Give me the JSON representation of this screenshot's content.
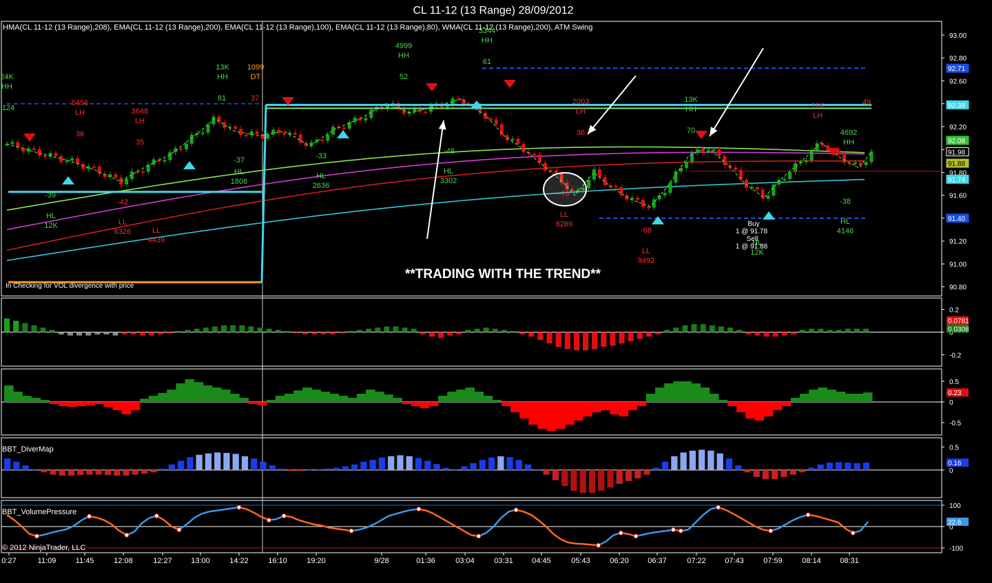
{
  "title": "CL 11-12 (13 Range)  28/09/2012",
  "indicator_legend": "HMA(CL 11-12 (13 Range),208), EMA(CL 11-12 (13 Range),200), EMA(CL 11-12 (13 Range),100), EMA(CL 11-12 (13 Range),80), WMA(CL 11-12 (13 Range),200), ATM Swing",
  "headline": "**TRADING WITH THE TREND**",
  "note": "In Checking for VOL divergence with price",
  "copyright": "© 2012 NinjaTrader, LLC",
  "trade_note": [
    "Buy",
    "1 @ 91.78",
    "Sell",
    "1 @ 91.88"
  ],
  "colors": {
    "background": "#000000",
    "up": "#1aa31a",
    "down": "#e01010",
    "grid": "#ffffff",
    "swing_green": "#4cd44c",
    "swing_red": "#ff2a2a",
    "cyan": "#40d8e8",
    "orange": "#ff9a1e"
  },
  "chart_data": [
    {
      "type": "candlestick",
      "panel": "price",
      "y_ticks": [
        "93.00",
        "92.80",
        "92.60",
        "92.40",
        "92.20",
        "92.00",
        "91.80",
        "91.60",
        "91.40",
        "91.20",
        "91.00",
        "90.80"
      ],
      "ylim": [
        90.72,
        93.12
      ],
      "x_ticks": [
        "0:27",
        "11:09",
        "11:45",
        "12:08",
        "12:27",
        "13:00",
        "14:22",
        "16:10",
        "19:20",
        "9/28",
        "01:36",
        "03:04",
        "03:31",
        "04:45",
        "05:43",
        "06:20",
        "06:37",
        "07:22",
        "07:43",
        "07:59",
        "08:14",
        "08:31"
      ],
      "price_path": [
        [
          0,
          92.05
        ],
        [
          5,
          91.97
        ],
        [
          10,
          91.9
        ],
        [
          14,
          91.82
        ],
        [
          18,
          91.72
        ],
        [
          22,
          91.85
        ],
        [
          26,
          91.96
        ],
        [
          30,
          92.13
        ],
        [
          33,
          92.27
        ],
        [
          36,
          92.16
        ],
        [
          40,
          92.12
        ],
        [
          44,
          92.16
        ],
        [
          48,
          92.03
        ],
        [
          52,
          92.18
        ],
        [
          56,
          92.27
        ],
        [
          60,
          92.4
        ],
        [
          64,
          92.32
        ],
        [
          68,
          92.38
        ],
        [
          72,
          92.44
        ],
        [
          76,
          92.29
        ],
        [
          79,
          92.11
        ],
        [
          82,
          92.0
        ],
        [
          85,
          91.86
        ],
        [
          88,
          91.72
        ],
        [
          90,
          91.6
        ],
        [
          93,
          91.8
        ],
        [
          96,
          91.66
        ],
        [
          99,
          91.56
        ],
        [
          102,
          91.5
        ],
        [
          105,
          91.7
        ],
        [
          108,
          91.94
        ],
        [
          111,
          92.02
        ],
        [
          114,
          91.88
        ],
        [
          117,
          91.7
        ],
        [
          120,
          91.58
        ],
        [
          123,
          91.76
        ],
        [
          126,
          91.9
        ],
        [
          129,
          92.06
        ],
        [
          132,
          91.93
        ],
        [
          135,
          91.84
        ],
        [
          137,
          91.98
        ]
      ],
      "candle_count": 160,
      "right_labels": [
        {
          "value": 92.71,
          "text": "92.71",
          "color": "#1a4fe8"
        },
        {
          "value": 92.39,
          "text": "92.39",
          "color": "#40d8e8"
        },
        {
          "value": 92.08,
          "text": "92.08",
          "color": "#2ec82e"
        },
        {
          "value": 91.98,
          "text": "91.98",
          "color": "#000000"
        },
        {
          "value": 91.88,
          "text": "91.88",
          "color": "#b0c020"
        },
        {
          "value": 91.74,
          "text": "91.74",
          "color": "#40d8e8"
        },
        {
          "value": 91.4,
          "text": "91.40",
          "color": "#1a4fe8"
        }
      ],
      "swing_labels": [
        {
          "lines": [
            "24K",
            "HH"
          ],
          "color": "#4cd44c"
        },
        {
          "lines": [
            "124"
          ],
          "color": "#4cd44c"
        },
        {
          "lines": [
            "5456",
            "LH"
          ],
          "color": "#ff2a2a"
        },
        {
          "lines": [
            "36"
          ],
          "color": "#ff2a2a"
        },
        {
          "lines": [
            "3648",
            "LH"
          ],
          "color": "#ff2a2a"
        },
        {
          "lines": [
            "35"
          ],
          "color": "#ff2a2a"
        },
        {
          "lines": [
            "13K",
            "HH"
          ],
          "color": "#4cd44c"
        },
        {
          "lines": [
            "81"
          ],
          "color": "#4cd44c"
        },
        {
          "lines": [
            "1099",
            "DT"
          ],
          "color": "#ffa020"
        },
        {
          "lines": [
            "37"
          ],
          "color": "#ff2a2a"
        },
        {
          "lines": [
            "4999",
            "HH"
          ],
          "color": "#4cd44c"
        },
        {
          "lines": [
            "52"
          ],
          "color": "#4cd44c"
        },
        {
          "lines": [
            "3344",
            "HH"
          ],
          "color": "#4cd44c"
        },
        {
          "lines": [
            "61"
          ],
          "color": "#4cd44c"
        },
        {
          "lines": [
            "2003",
            "LH"
          ],
          "color": "#ff2a2a"
        },
        {
          "lines": [
            "36"
          ],
          "color": "#ff2a2a"
        },
        {
          "lines": [
            "13K",
            "HH"
          ],
          "color": "#4cd44c"
        },
        {
          "lines": [
            "70"
          ],
          "color": "#4cd44c"
        },
        {
          "lines": [
            "11K",
            "LH"
          ],
          "color": "#ff2a2a"
        },
        {
          "lines": [
            "4692",
            "HH"
          ],
          "color": "#4cd44c"
        },
        {
          "lines": [
            "49"
          ],
          "color": "#ff2a2a"
        },
        {
          "lines": [
            "-39"
          ],
          "color": "#4cd44c"
        },
        {
          "lines": [
            "HL",
            "12K"
          ],
          "color": "#4cd44c"
        },
        {
          "lines": [
            "-42"
          ],
          "color": "#ff2a2a"
        },
        {
          "lines": [
            "LL",
            "6326"
          ],
          "color": "#ff2a2a"
        },
        {
          "lines": [
            "LL",
            "4439"
          ],
          "color": "#ff2a2a"
        },
        {
          "lines": [
            "-37"
          ],
          "color": "#4cd44c"
        },
        {
          "lines": [
            "HL",
            "1808"
          ],
          "color": "#4cd44c"
        },
        {
          "lines": [
            "-33"
          ],
          "color": "#4cd44c"
        },
        {
          "lines": [
            "HL",
            "2636"
          ],
          "color": "#4cd44c"
        },
        {
          "lines": [
            "-48"
          ],
          "color": "#4cd44c"
        },
        {
          "lines": [
            "HL",
            "3302"
          ],
          "color": "#4cd44c"
        },
        {
          "lines": [
            "-70"
          ],
          "color": "#ff2a2a"
        },
        {
          "lines": [
            "LL",
            "8289"
          ],
          "color": "#ff2a2a"
        },
        {
          "lines": [
            "-68"
          ],
          "color": "#ff2a2a"
        },
        {
          "lines": [
            "LL",
            "9492"
          ],
          "color": "#ff2a2a"
        },
        {
          "lines": [
            "HL",
            "12K"
          ],
          "color": "#4cd44c"
        },
        {
          "lines": [
            "-38"
          ],
          "color": "#4cd44c"
        },
        {
          "lines": [
            "HL",
            "4146"
          ],
          "color": "#4cd44c"
        }
      ]
    },
    {
      "type": "histogram",
      "panel": "oscillator_1",
      "y_ticks": [
        "0.2",
        "0",
        "-0.2"
      ],
      "ylim": [
        -0.3,
        0.3
      ],
      "value_label": "0.0308",
      "value_label_red": "0.0781",
      "values": [
        0.12,
        0.1,
        0.08,
        0.06,
        0.04,
        0.02,
        -0.02,
        -0.03,
        -0.03,
        -0.03,
        -0.02,
        -0.02,
        -0.03,
        -0.02,
        -0.02,
        -0.03,
        -0.03,
        -0.02,
        -0.01,
        0.01,
        0.02,
        0.03,
        0.04,
        0.05,
        0.06,
        0.06,
        0.06,
        0.05,
        0.04,
        0.03,
        0.02,
        0.01,
        -0.01,
        -0.02,
        -0.02,
        -0.02,
        -0.02,
        -0.01,
        0.01,
        0.02,
        0.03,
        0.04,
        0.05,
        0.05,
        0.04,
        0.03,
        -0.02,
        -0.04,
        -0.05,
        -0.03,
        -0.02,
        0.02,
        0.03,
        0.04,
        0.03,
        0.02,
        0.01,
        -0.02,
        -0.04,
        -0.07,
        -0.1,
        -0.13,
        -0.15,
        -0.16,
        -0.16,
        -0.15,
        -0.13,
        -0.12,
        -0.1,
        -0.08,
        -0.06,
        -0.04,
        -0.02,
        0.02,
        0.04,
        0.06,
        0.07,
        0.07,
        0.06,
        0.05,
        0.04,
        0.02,
        -0.02,
        -0.03,
        -0.04,
        -0.04,
        -0.03,
        -0.02,
        0.02,
        0.03,
        0.03,
        0.02,
        0.02,
        0.03,
        0.03,
        0.03
      ]
    },
    {
      "type": "histogram",
      "panel": "oscillator_2",
      "y_ticks": [
        "0.5",
        "0",
        "-0.5"
      ],
      "ylim": [
        -0.8,
        0.8
      ],
      "value_label": "0.23",
      "values": [
        0.4,
        0.25,
        0.15,
        0.1,
        0.05,
        -0.05,
        -0.1,
        -0.12,
        -0.1,
        -0.08,
        -0.05,
        -0.12,
        -0.2,
        -0.3,
        -0.2,
        0.08,
        0.15,
        0.22,
        0.3,
        0.45,
        0.55,
        0.48,
        0.4,
        0.35,
        0.3,
        0.2,
        0.1,
        -0.05,
        -0.08,
        0.05,
        0.15,
        0.2,
        0.28,
        0.35,
        0.3,
        0.25,
        0.2,
        0.15,
        0.1,
        0.2,
        0.3,
        0.25,
        0.18,
        0.1,
        -0.05,
        -0.1,
        -0.15,
        -0.1,
        0.15,
        0.25,
        0.3,
        0.35,
        0.25,
        0.15,
        0.05,
        -0.1,
        -0.25,
        -0.4,
        -0.55,
        -0.65,
        -0.7,
        -0.65,
        -0.55,
        -0.45,
        -0.35,
        -0.25,
        -0.2,
        -0.3,
        -0.35,
        -0.2,
        -0.1,
        0.2,
        0.35,
        0.45,
        0.5,
        0.5,
        0.45,
        0.35,
        0.2,
        0.05,
        -0.1,
        -0.25,
        -0.4,
        -0.45,
        -0.35,
        -0.2,
        -0.1,
        0.1,
        0.2,
        0.3,
        0.35,
        0.3,
        0.25,
        0.2,
        0.2,
        0.23
      ]
    },
    {
      "type": "histogram",
      "panel": "diver_map",
      "label": "BBT_DiverMap",
      "y_ticks": [
        "0.5",
        "0"
      ],
      "ylim": [
        -0.6,
        0.7
      ],
      "value_label": "0.16",
      "values": [
        0.25,
        0.18,
        0.1,
        0.02,
        -0.05,
        -0.1,
        -0.12,
        -0.12,
        -0.11,
        -0.1,
        -0.1,
        -0.11,
        -0.12,
        -0.12,
        -0.1,
        -0.08,
        -0.05,
        0.03,
        0.12,
        0.2,
        0.28,
        0.33,
        0.36,
        0.38,
        0.37,
        0.35,
        0.3,
        0.25,
        0.18,
        0.1,
        0.03,
        -0.02,
        -0.02,
        0.0,
        0.02,
        0.03,
        0.05,
        0.08,
        0.12,
        0.18,
        0.22,
        0.27,
        0.3,
        0.32,
        0.3,
        0.26,
        0.2,
        0.13,
        0.05,
        0.02,
        0.08,
        0.15,
        0.22,
        0.27,
        0.3,
        0.28,
        0.22,
        0.12,
        0.02,
        -0.1,
        -0.22,
        -0.35,
        -0.45,
        -0.5,
        -0.5,
        -0.45,
        -0.38,
        -0.3,
        -0.24,
        -0.18,
        -0.1,
        0.05,
        0.18,
        0.3,
        0.38,
        0.42,
        0.44,
        0.42,
        0.36,
        0.25,
        0.1,
        -0.05,
        -0.15,
        -0.2,
        -0.2,
        -0.15,
        -0.1,
        -0.05,
        0.05,
        0.12,
        0.16,
        0.17,
        0.16,
        0.15,
        0.16
      ]
    },
    {
      "type": "line",
      "panel": "volume_pressure",
      "label": "BBT_VolumePressure",
      "y_ticks": [
        "100",
        "0",
        "-100"
      ],
      "ylim": [
        -100,
        100
      ],
      "value_label": "22.6",
      "values": [
        55,
        30,
        0,
        -35,
        -45,
        -38,
        -28,
        -20,
        -12,
        5,
        30,
        48,
        42,
        30,
        10,
        -20,
        -40,
        -25,
        15,
        40,
        50,
        30,
        0,
        -15,
        10,
        40,
        60,
        70,
        75,
        80,
        85,
        90,
        82,
        65,
        45,
        30,
        35,
        50,
        45,
        30,
        20,
        10,
        5,
        -5,
        -10,
        -15,
        -20,
        -15,
        -5,
        10,
        30,
        50,
        60,
        70,
        78,
        82,
        75,
        60,
        40,
        20,
        0,
        -20,
        -40,
        -45,
        -30,
        0,
        40,
        70,
        78,
        70,
        55,
        30,
        0,
        -35,
        -60,
        -75,
        -80,
        -82,
        -85,
        -88,
        -70,
        -40,
        -30,
        -35,
        -45,
        -38,
        -30,
        -25,
        -20,
        -15,
        -20,
        -15,
        20,
        55,
        82,
        90,
        78,
        60,
        40,
        20,
        0,
        -15,
        -20,
        -10,
        10,
        30,
        45,
        55,
        50,
        40,
        30,
        20,
        -10,
        -30,
        -20,
        22.6
      ]
    }
  ]
}
